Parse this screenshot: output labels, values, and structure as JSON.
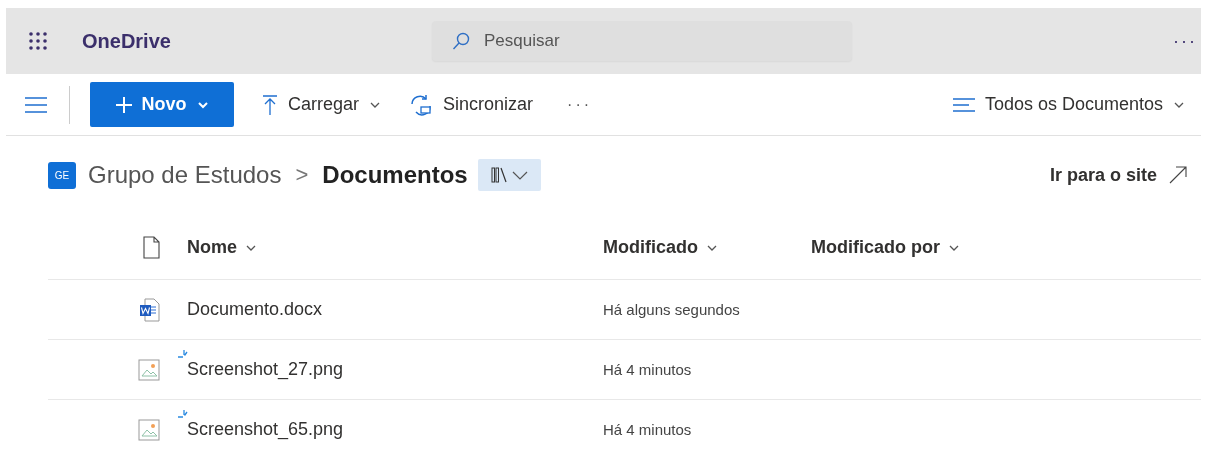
{
  "app": {
    "title": "OneDrive",
    "more": "···"
  },
  "search": {
    "placeholder": "Pesquisar"
  },
  "toolbar": {
    "new_button": "Novo",
    "upload": "Carregar",
    "sync": "Sincronizar",
    "more": "···",
    "view": "Todos os Documentos"
  },
  "breadcrumb": {
    "site_badge": "GE",
    "site": "Grupo de Estudos",
    "separator": ">",
    "library": "Documentos",
    "go_to_site": "Ir para o site"
  },
  "table": {
    "columns": [
      "Nome",
      "Modificado",
      "Modificado por"
    ],
    "rows": [
      {
        "kind": "word",
        "name": "Documento.docx",
        "modified": "Há alguns segundos",
        "new": false
      },
      {
        "kind": "image",
        "name": "Screenshot_27.png",
        "modified": "Há 4 minutos",
        "new": true
      },
      {
        "kind": "image",
        "name": "Screenshot_65.png",
        "modified": "Há 4 minutos",
        "new": true
      }
    ]
  }
}
